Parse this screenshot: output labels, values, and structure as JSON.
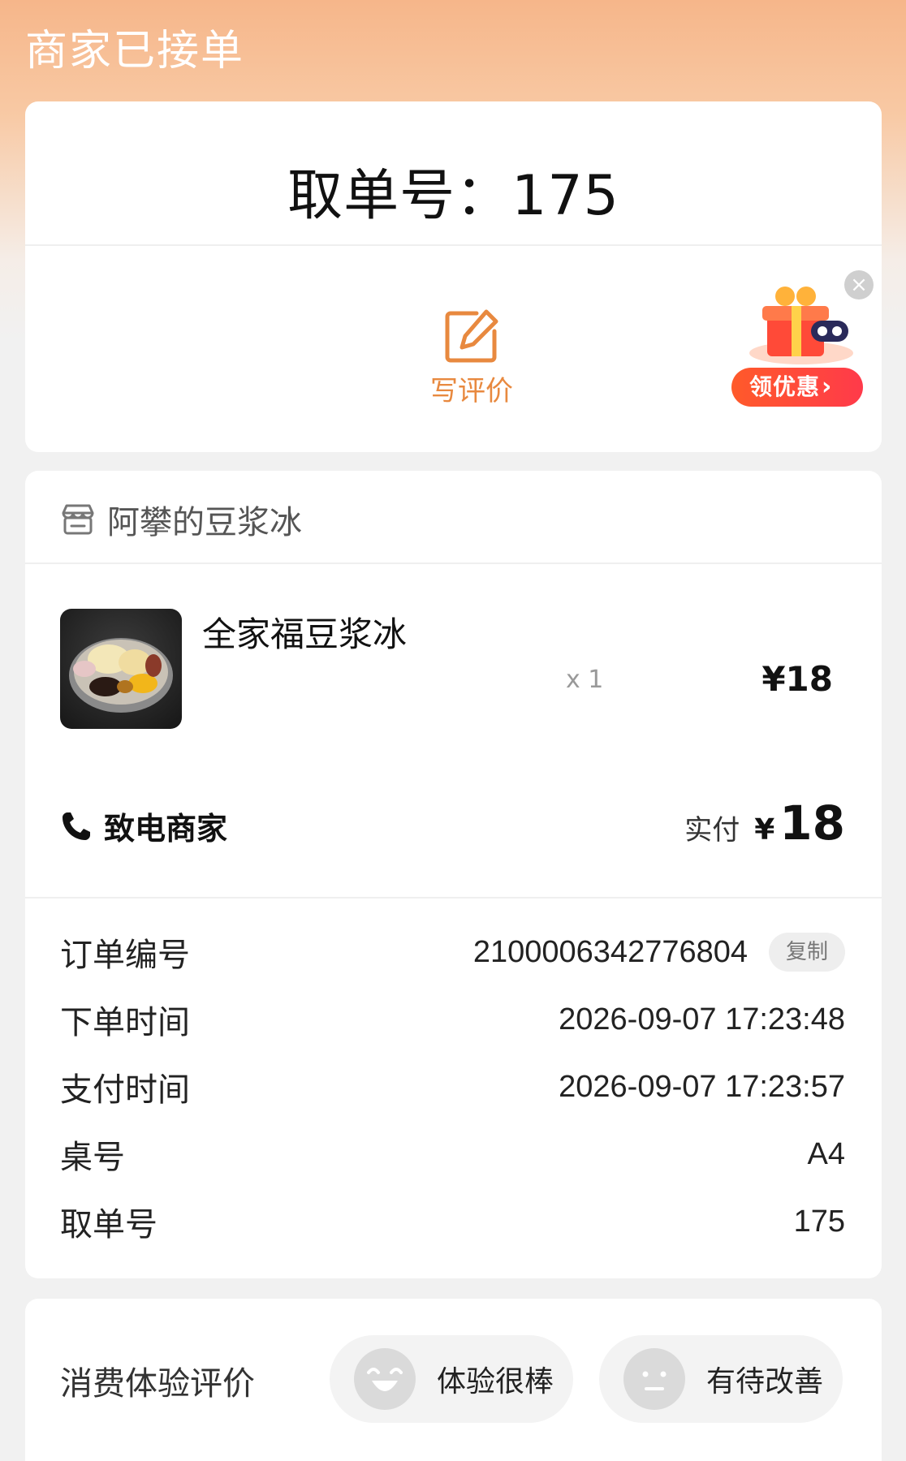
{
  "header": {
    "status": "商家已接单"
  },
  "pickup": {
    "label": "取单号：",
    "number": "175",
    "review_label": "写评价",
    "promo_label": "领优惠",
    "promo_close": "×"
  },
  "shop": {
    "name": "阿攀的豆浆冰"
  },
  "item": {
    "name": "全家福豆浆冰",
    "quantity": "x 1",
    "price": "¥18"
  },
  "summary": {
    "call_label": "致电商家",
    "paid_label": "实付",
    "paid_currency": "¥",
    "paid_value": "18"
  },
  "details": {
    "rows": [
      {
        "label": "订单编号",
        "value": "2100006342776804"
      },
      {
        "label": "下单时间",
        "value": "2026-09-07 17:23:48"
      },
      {
        "label": "支付时间",
        "value": "2026-09-07 17:23:57"
      },
      {
        "label": "桌号",
        "value": "A4"
      },
      {
        "label": "取单号",
        "value": "175"
      }
    ],
    "copy_label": "复制"
  },
  "feedback": {
    "label": "消费体验评价",
    "great": "体验很棒",
    "improve": "有待改善"
  },
  "colors": {
    "accent": "#e8893f",
    "promo": "#ff4a38"
  }
}
